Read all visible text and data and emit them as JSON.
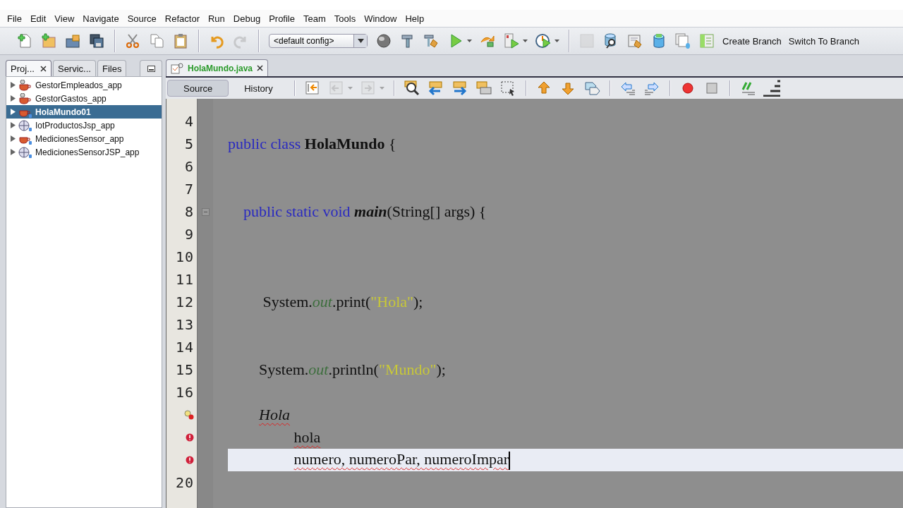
{
  "menu": [
    "File",
    "Edit",
    "View",
    "Navigate",
    "Source",
    "Refactor",
    "Run",
    "Debug",
    "Profile",
    "Team",
    "Tools",
    "Window",
    "Help"
  ],
  "toolbar": [
    {
      "kind": "new-file",
      "disabled": false,
      "menu": false
    },
    {
      "kind": "new-project",
      "disabled": false,
      "menu": false
    },
    {
      "kind": "open-project",
      "disabled": false,
      "menu": false
    },
    {
      "kind": "save-all",
      "disabled": false,
      "menu": false
    },
    {
      "kind": "separator"
    },
    {
      "kind": "cut",
      "disabled": false,
      "menu": false
    },
    {
      "kind": "copy",
      "disabled": false,
      "menu": false
    },
    {
      "kind": "paste",
      "disabled": false,
      "menu": false
    },
    {
      "kind": "separator"
    },
    {
      "kind": "undo",
      "disabled": false,
      "menu": false
    },
    {
      "kind": "redo",
      "disabled": true,
      "menu": false
    },
    {
      "kind": "separator"
    },
    {
      "kind": "config",
      "label": "<default config>"
    },
    {
      "kind": "globe",
      "disabled": false,
      "menu": false
    },
    {
      "kind": "hammer",
      "disabled": false,
      "menu": false
    },
    {
      "kind": "clean-build",
      "disabled": false,
      "menu": false
    },
    {
      "kind": "run",
      "disabled": false,
      "menu": true
    },
    {
      "kind": "apply",
      "disabled": false,
      "menu": false
    },
    {
      "kind": "test",
      "disabled": false,
      "menu": true
    },
    {
      "kind": "profile",
      "disabled": false,
      "menu": true
    },
    {
      "kind": "separator"
    },
    {
      "kind": "blank",
      "disabled": true,
      "menu": false
    },
    {
      "kind": "db-search",
      "disabled": false,
      "menu": false
    },
    {
      "kind": "doc-clean",
      "disabled": false,
      "menu": false
    },
    {
      "kind": "database",
      "disabled": false,
      "menu": false
    },
    {
      "kind": "docs",
      "disabled": false,
      "menu": false
    },
    {
      "kind": "green-doc",
      "disabled": false,
      "menu": false
    },
    {
      "kind": "text",
      "label": "Create Branch"
    },
    {
      "kind": "text",
      "label": "Switch To Branch"
    }
  ],
  "panel_tabs": [
    {
      "label": "Proj...",
      "selected": true,
      "closable": true
    },
    {
      "label": "Servic...",
      "selected": false,
      "closable": false
    },
    {
      "label": "Files",
      "selected": false,
      "closable": false
    }
  ],
  "projects": [
    {
      "name": "GestorEmpleados_app",
      "kind": "java",
      "selected": false
    },
    {
      "name": "GestorGastos_app",
      "kind": "java",
      "selected": false
    },
    {
      "name": "HolaMundo01",
      "kind": "java-maven",
      "selected": true
    },
    {
      "name": "IotProductosJsp_app",
      "kind": "web-maven",
      "selected": false
    },
    {
      "name": "MedicionesSensor_app",
      "kind": "java-maven",
      "selected": false
    },
    {
      "name": "MedicionesSensorJSP_app",
      "kind": "web-maven",
      "selected": false
    }
  ],
  "editor_tabs": [
    {
      "label": "HolaMundo.java",
      "selected": true
    }
  ],
  "view_tabs": [
    {
      "label": "Source",
      "selected": true
    },
    {
      "label": "History",
      "selected": false
    }
  ],
  "editor_toolbar": [
    {
      "kind": "last-edit",
      "disabled": false,
      "menu": false
    },
    {
      "kind": "back",
      "disabled": true,
      "menu": true
    },
    {
      "kind": "forward",
      "disabled": true,
      "menu": true
    },
    {
      "kind": "separator"
    },
    {
      "kind": "find",
      "disabled": false,
      "menu": false
    },
    {
      "kind": "find-prev",
      "disabled": false,
      "menu": false
    },
    {
      "kind": "find-next",
      "disabled": false,
      "menu": false
    },
    {
      "kind": "highlight",
      "disabled": false,
      "menu": false
    },
    {
      "kind": "select",
      "disabled": false,
      "menu": false
    },
    {
      "kind": "separator"
    },
    {
      "kind": "bookmark-prev",
      "disabled": false,
      "menu": false
    },
    {
      "kind": "bookmark-next",
      "disabled": false,
      "menu": false
    },
    {
      "kind": "bookmark-toggle",
      "disabled": false,
      "menu": false
    },
    {
      "kind": "separator"
    },
    {
      "kind": "shift-left",
      "disabled": false,
      "menu": false
    },
    {
      "kind": "shift-right",
      "disabled": false,
      "menu": false
    },
    {
      "kind": "separator"
    },
    {
      "kind": "record",
      "disabled": false,
      "menu": false
    },
    {
      "kind": "stop",
      "disabled": false,
      "menu": false
    },
    {
      "kind": "separator"
    },
    {
      "kind": "comment",
      "disabled": false,
      "menu": false
    },
    {
      "kind": "uncomment",
      "disabled": false,
      "menu": false
    }
  ],
  "code_lines": [
    {
      "number": "4",
      "kind": "plain",
      "current": false
    },
    {
      "number": "5",
      "kind": "plain",
      "current": false,
      "tokens": [
        {
          "text": "public class ",
          "kind": "keyword"
        },
        {
          "text": "HolaMundo",
          "kind": "classname"
        },
        {
          "text": " {",
          "kind": "plain"
        }
      ]
    },
    {
      "number": "6",
      "kind": "plain",
      "current": false
    },
    {
      "number": "7",
      "kind": "plain",
      "current": false
    },
    {
      "number": "8",
      "kind": "fold",
      "current": false,
      "tokens": [
        {
          "text": "    public static void ",
          "kind": "keyword"
        },
        {
          "text": "main",
          "kind": "method"
        },
        {
          "text": "(String[] args) {",
          "kind": "plain"
        }
      ]
    },
    {
      "number": "9",
      "kind": "plain",
      "current": false
    },
    {
      "number": "10",
      "kind": "plain",
      "current": false
    },
    {
      "number": "11",
      "kind": "plain",
      "current": false
    },
    {
      "number": "12",
      "kind": "plain",
      "current": false,
      "tokens": [
        {
          "text": "         System.",
          "kind": "plain"
        },
        {
          "text": "out",
          "kind": "field"
        },
        {
          "text": ".print(",
          "kind": "plain"
        },
        {
          "text": "\"Hola\"",
          "kind": "string"
        },
        {
          "text": ");",
          "kind": "plain"
        }
      ]
    },
    {
      "number": "13",
      "kind": "plain",
      "current": false
    },
    {
      "number": "14",
      "kind": "plain",
      "current": false
    },
    {
      "number": "15",
      "kind": "plain",
      "current": false,
      "tokens": [
        {
          "text": "        System.",
          "kind": "plain"
        },
        {
          "text": "out",
          "kind": "field"
        },
        {
          "text": ".println(",
          "kind": "plain"
        },
        {
          "text": "\"Mundo\"",
          "kind": "string"
        },
        {
          "text": ");",
          "kind": "plain"
        }
      ]
    },
    {
      "number": "16",
      "kind": "plain",
      "current": false
    },
    {
      "kind": "hint-error",
      "current": false,
      "tokens": [
        {
          "text": "        Hola",
          "kind": "unknown-type"
        }
      ]
    },
    {
      "kind": "error",
      "current": false,
      "tokens": [
        {
          "text": "                 hola",
          "kind": "error"
        }
      ]
    },
    {
      "kind": "error",
      "current": true,
      "tokens": [
        {
          "text": "                 numero, numeroPar, numeroImpar",
          "kind": "error"
        }
      ]
    },
    {
      "number": "20",
      "kind": "plain",
      "current": false
    }
  ]
}
